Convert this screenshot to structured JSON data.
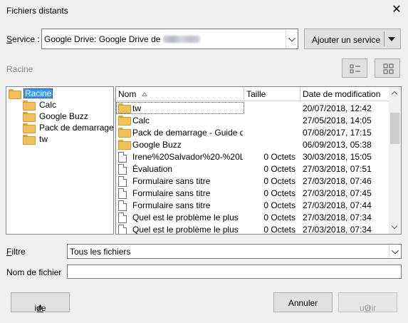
{
  "window": {
    "title": "Fichiers distants"
  },
  "service": {
    "label": "Service :",
    "value": "Google Drive: Google Drive de",
    "add_button": "Ajouter un service"
  },
  "path": {
    "current": "Racine"
  },
  "tree": {
    "root": "Racine",
    "items": [
      "Calc",
      "Google Buzz",
      "Pack de demarrage - Guide de l'utilisateur",
      "tw"
    ]
  },
  "files": {
    "columns": {
      "name": "Nom",
      "size": "Taille",
      "date": "Date de modification"
    },
    "rows": [
      {
        "name": "tw",
        "size": "",
        "date": "20/07/2018, 12:42",
        "type": "folder"
      },
      {
        "name": "Calc",
        "size": "",
        "date": "27/05/2018, 14:05",
        "type": "folder"
      },
      {
        "name": "Pack de demarrage - Guide de l'utilisateur",
        "size": "",
        "date": "07/08/2017, 17:15",
        "type": "folder"
      },
      {
        "name": "Google Buzz",
        "size": "",
        "date": "06/09/2013, 05:38",
        "type": "folder"
      },
      {
        "name": "Irene%20Salvador%20-%20L",
        "size": "0 Octets",
        "date": "30/03/2018, 15:05",
        "type": "file"
      },
      {
        "name": "Évaluation",
        "size": "0 Octets",
        "date": "27/03/2018, 07:51",
        "type": "file"
      },
      {
        "name": "Formulaire sans titre",
        "size": "0 Octets",
        "date": "27/03/2018, 07:46",
        "type": "file"
      },
      {
        "name": "Formulaire sans titre",
        "size": "0 Octets",
        "date": "27/03/2018, 07:45",
        "type": "file"
      },
      {
        "name": "Formulaire sans titre",
        "size": "0 Octets",
        "date": "27/03/2018, 07:44",
        "type": "file"
      },
      {
        "name": "Quel est le problème le plus",
        "size": "0 Octets",
        "date": "27/03/2018, 07:34",
        "type": "file"
      },
      {
        "name": "Quel est le problème le plus",
        "size": "0 Octets",
        "date": "27/03/2018, 07:34",
        "type": "file"
      }
    ]
  },
  "filter": {
    "label": "Filtre",
    "value": "Tous les fichiers"
  },
  "filename": {
    "label": "Nom de fichier",
    "value": ""
  },
  "buttons": {
    "help": "Aide",
    "cancel": "Annuler",
    "open": "Ouvrir"
  }
}
